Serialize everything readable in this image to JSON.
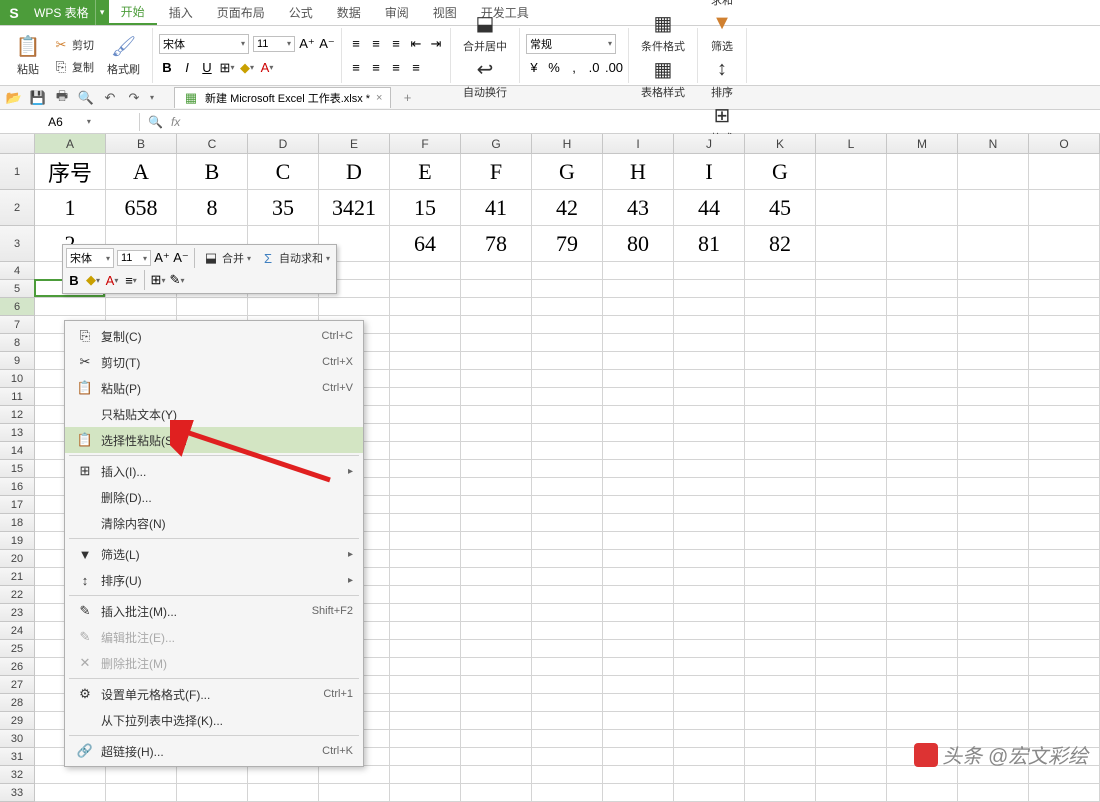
{
  "app": {
    "name": "WPS 表格",
    "icon": "S"
  },
  "menu": [
    "开始",
    "插入",
    "页面布局",
    "公式",
    "数据",
    "审阅",
    "视图",
    "开发工具"
  ],
  "ribbon": {
    "paste": "粘贴",
    "cut": "剪切",
    "copy": "复制",
    "format_painter": "格式刷",
    "font": "宋体",
    "font_size": "11",
    "merge": "合并居中",
    "wrap": "自动换行",
    "number_format": "常规",
    "cond_fmt": "条件格式",
    "table_style": "表格样式",
    "sum": "求和",
    "filter": "筛选",
    "sort": "排序",
    "format": "格式"
  },
  "doc_tab": "新建 Microsoft Excel 工作表.xlsx *",
  "namebox": "A6",
  "col_headers": [
    "A",
    "B",
    "C",
    "D",
    "E",
    "F",
    "G",
    "H",
    "I",
    "J",
    "K",
    "L",
    "M",
    "N",
    "O"
  ],
  "rows_tall": [
    1,
    2,
    3
  ],
  "data_rows": [
    [
      "序号",
      "A",
      "B",
      "C",
      "D",
      "E",
      "F",
      "G",
      "H",
      "I",
      "G",
      "",
      "",
      "",
      ""
    ],
    [
      "1",
      "658",
      "8",
      "35",
      "3421",
      "15",
      "41",
      "42",
      "43",
      "44",
      "45",
      "",
      "",
      "",
      ""
    ],
    [
      "2",
      "",
      "",
      "",
      "",
      "64",
      "78",
      "79",
      "80",
      "81",
      "82",
      "",
      "",
      "",
      ""
    ]
  ],
  "minibar": {
    "font": "宋体",
    "size": "11",
    "merge": "合并",
    "autosum": "自动求和"
  },
  "ctx": [
    {
      "ico": "⎘",
      "label": "复制(C)",
      "sc": "Ctrl+C"
    },
    {
      "ico": "✂",
      "label": "剪切(T)",
      "sc": "Ctrl+X"
    },
    {
      "ico": "📋",
      "label": "粘贴(P)",
      "sc": "Ctrl+V"
    },
    {
      "ico": "",
      "label": "只粘贴文本(Y)"
    },
    {
      "ico": "📋",
      "label": "选择性粘贴(S)...",
      "hover": true
    },
    {
      "sep": true
    },
    {
      "ico": "⊞",
      "label": "插入(I)...",
      "arrow": true
    },
    {
      "ico": "",
      "label": "删除(D)..."
    },
    {
      "ico": "",
      "label": "清除内容(N)"
    },
    {
      "sep": true
    },
    {
      "ico": "▼",
      "label": "筛选(L)",
      "arrow": true
    },
    {
      "ico": "↕",
      "label": "排序(U)",
      "arrow": true
    },
    {
      "sep": true
    },
    {
      "ico": "✎",
      "label": "插入批注(M)...",
      "sc": "Shift+F2"
    },
    {
      "ico": "✎",
      "label": "编辑批注(E)...",
      "disabled": true
    },
    {
      "ico": "✕",
      "label": "删除批注(M)",
      "disabled": true
    },
    {
      "sep": true
    },
    {
      "ico": "⚙",
      "label": "设置单元格格式(F)...",
      "sc": "Ctrl+1"
    },
    {
      "ico": "",
      "label": "从下拉列表中选择(K)..."
    },
    {
      "sep": true
    },
    {
      "ico": "🔗",
      "label": "超链接(H)...",
      "sc": "Ctrl+K"
    }
  ],
  "watermark": "头条 @宏文彩绘"
}
